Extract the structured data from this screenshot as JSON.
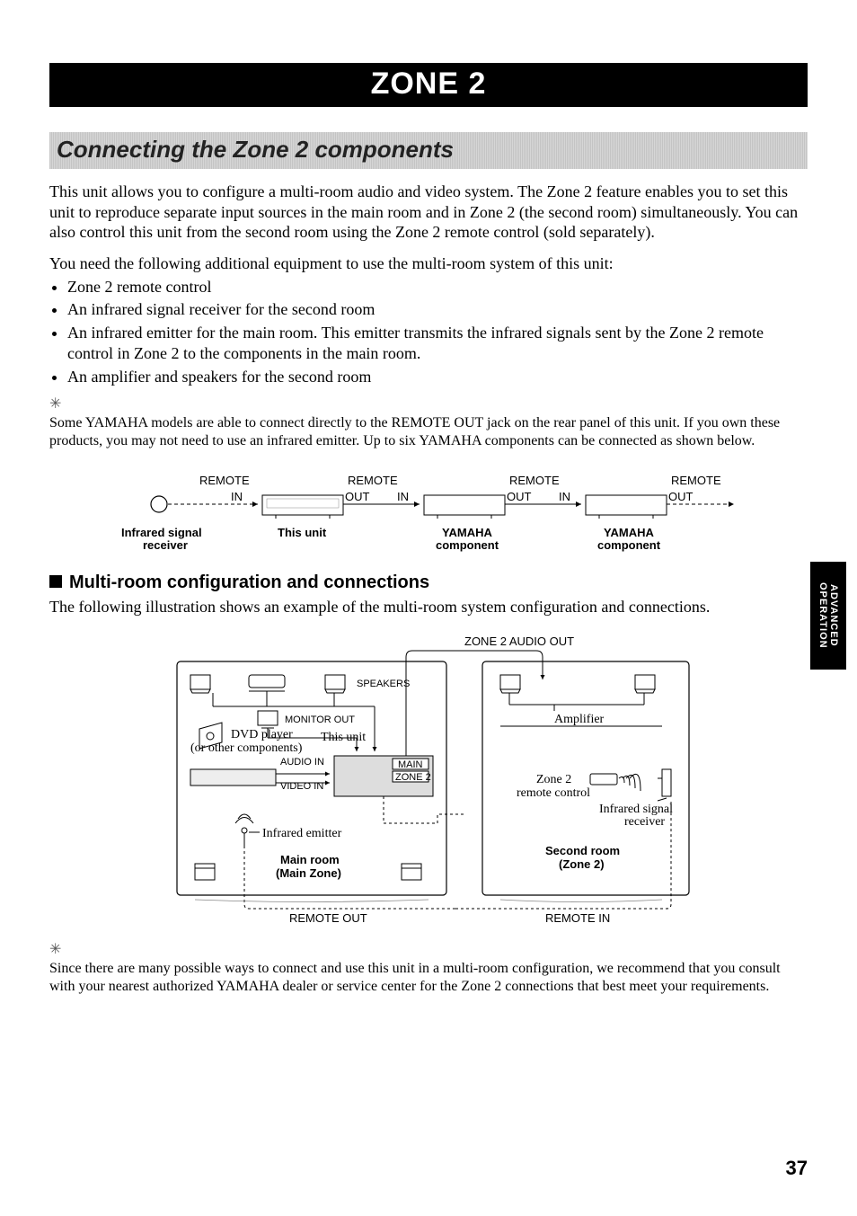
{
  "title": "ZONE 2",
  "section_heading": "Connecting the Zone 2 components",
  "intro_p1": "This unit allows you to configure a multi-room audio and video system. The Zone 2 feature enables you to set this unit to reproduce separate input sources in the main room and in Zone 2 (the second room) simultaneously. You can also control this unit from the second room using the Zone 2 remote control (sold separately).",
  "intro_p2": "You need the following additional equipment to use the multi-room system of this unit:",
  "bullets": [
    "Zone 2 remote control",
    "An infrared signal receiver for the second room",
    "An infrared emitter for the main room. This emitter transmits the infrared signals sent by the Zone 2 remote control in Zone 2 to the components in the main room.",
    "An amplifier and speakers for the second room"
  ],
  "tip1": "Some YAMAHA models are able to connect directly to the REMOTE OUT jack on the rear panel of this unit. If you own these products, you may not need to use an infrared emitter. Up to six YAMAHA components can be connected as shown below.",
  "diagram1": {
    "remote": "REMOTE",
    "in": "IN",
    "out": "OUT",
    "ir_receiver_l1": "Infrared signal",
    "ir_receiver_l2": "receiver",
    "this_unit": "This unit",
    "yamaha_l1": "YAMAHA",
    "yamaha_l2": "component"
  },
  "subheading": "Multi-room configuration and connections",
  "sub_p1": "The following illustration shows an example of the multi-room system configuration and connections.",
  "diagram2": {
    "zone2_audio_out": "ZONE 2 AUDIO OUT",
    "speakers": "SPEAKERS",
    "amplifier": "Amplifier",
    "monitor_out": "MONITOR OUT",
    "dvd_player": "DVD player",
    "or_other": "(or other components)",
    "this_unit": "This unit",
    "audio_in": "AUDIO IN",
    "main": "MAIN",
    "zone2_btn": "ZONE 2",
    "video_in": "VIDEO IN",
    "zone2_rc_l1": "Zone 2",
    "zone2_rc_l2": "remote control",
    "ir_receiver_l1": "Infrared signal",
    "ir_receiver_l2": "receiver",
    "ir_emitter": "Infrared emitter",
    "main_room_l1": "Main room",
    "main_room_l2": "(Main Zone)",
    "second_room_l1": "Second room",
    "second_room_l2": "(Zone 2)",
    "remote_out": "REMOTE OUT",
    "remote_in": "REMOTE IN"
  },
  "tip2": "Since there are many possible ways to connect and use this unit in a multi-room configuration, we recommend that you consult with your nearest authorized YAMAHA dealer or service center for the Zone 2 connections that best meet your requirements.",
  "page_number": "37",
  "side_tab_l1": "ADVANCED",
  "side_tab_l2": "OPERATION"
}
